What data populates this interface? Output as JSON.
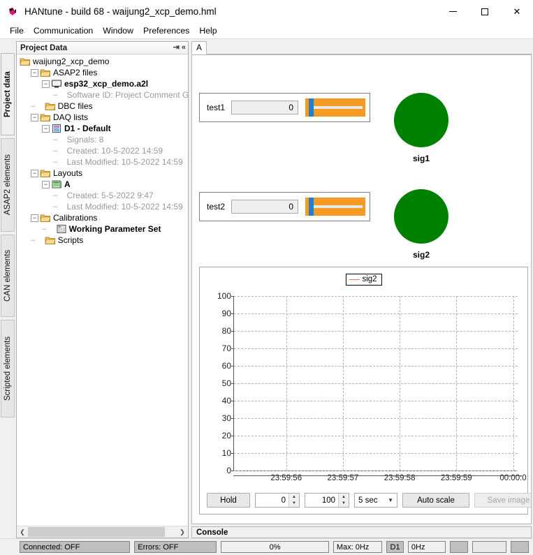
{
  "window": {
    "title": "HANtune - build 68 - waijung2_xcp_demo.hml",
    "icon": "hantune-logo-icon",
    "minimize_label": "",
    "maximize_label": "",
    "close_label": "✕"
  },
  "menubar": {
    "items": [
      "File",
      "Communication",
      "Window",
      "Preferences",
      "Help"
    ]
  },
  "vertical_tabs": [
    {
      "label": "Project data",
      "active": true
    },
    {
      "label": "ASAP2 elements",
      "active": false
    },
    {
      "label": "CAN elements",
      "active": false
    },
    {
      "label": "Scripted elements",
      "active": false
    }
  ],
  "tree_panel": {
    "header": "Project Data",
    "pin_icon": "pin-icon",
    "collapse_icon": "collapse-left-icon",
    "nodes": [
      {
        "label": "waijung2_xcp_demo",
        "depth": 0,
        "icon": "folder-icon",
        "expander": "",
        "style": "normal"
      },
      {
        "label": "ASAP2 files",
        "depth": 1,
        "icon": "folder-icon",
        "expander": "−",
        "style": "normal"
      },
      {
        "label": "esp32_xcp_demo.a2l",
        "depth": 2,
        "icon": "monitor-icon",
        "expander": "−",
        "style": "bold"
      },
      {
        "label": "Software ID: Project Comment Goes H",
        "depth": 3,
        "icon": "none",
        "expander": "",
        "style": "muted"
      },
      {
        "label": "DBC files",
        "depth": 1,
        "icon": "folder-icon",
        "expander": "",
        "style": "normal"
      },
      {
        "label": "DAQ lists",
        "depth": 1,
        "icon": "folder-icon",
        "expander": "−",
        "style": "normal"
      },
      {
        "label": "D1 - Default",
        "depth": 2,
        "icon": "list-icon",
        "expander": "−",
        "style": "bold"
      },
      {
        "label": "Signals: 8",
        "depth": 3,
        "icon": "none",
        "expander": "",
        "style": "muted"
      },
      {
        "label": "Created: 10-5-2022 14:59",
        "depth": 3,
        "icon": "none",
        "expander": "",
        "style": "muted"
      },
      {
        "label": "Last Modified: 10-5-2022 14:59",
        "depth": 3,
        "icon": "none",
        "expander": "",
        "style": "muted"
      },
      {
        "label": "Layouts",
        "depth": 1,
        "icon": "folder-icon",
        "expander": "−",
        "style": "normal"
      },
      {
        "label": "A",
        "depth": 2,
        "icon": "layout-icon",
        "expander": "−",
        "style": "bold"
      },
      {
        "label": "Created: 5-5-2022 9:47",
        "depth": 3,
        "icon": "none",
        "expander": "",
        "style": "muted"
      },
      {
        "label": "Last Modified: 10-5-2022 14:59",
        "depth": 3,
        "icon": "none",
        "expander": "",
        "style": "muted"
      },
      {
        "label": "Calibrations",
        "depth": 1,
        "icon": "folder-icon",
        "expander": "−",
        "style": "normal"
      },
      {
        "label": "Working Parameter Set",
        "depth": 2,
        "icon": "table-icon",
        "expander": "",
        "style": "bold"
      },
      {
        "label": "Scripts",
        "depth": 1,
        "icon": "folder-icon",
        "expander": "",
        "style": "normal"
      }
    ],
    "scroll_left_icon": "chevron-left-icon",
    "scroll_right_icon": "chevron-right-icon"
  },
  "layout_tabs": [
    {
      "label": "A",
      "active": true
    }
  ],
  "widgets": {
    "gauges": [
      {
        "label": "test1",
        "value": "0",
        "bar_color": "#f59a23",
        "knob_color": "#1f7fd0"
      },
      {
        "label": "test2",
        "value": "0",
        "bar_color": "#f59a23",
        "knob_color": "#1f7fd0"
      }
    ],
    "leds": [
      {
        "label": "sig1",
        "color": "#008000"
      },
      {
        "label": "sig2",
        "color": "#008000"
      }
    ]
  },
  "chart_data": {
    "type": "line",
    "title": "",
    "xlabel": "",
    "ylabel": "",
    "legend": [
      {
        "name": "sig2",
        "color": "#e8736a"
      }
    ],
    "legend_position": "top-center",
    "grid": true,
    "ylim": [
      0,
      100
    ],
    "yticks": [
      0,
      10,
      20,
      30,
      40,
      50,
      60,
      70,
      80,
      90,
      100
    ],
    "xticks": [
      "23:59:56",
      "23:59:57",
      "23:59:58",
      "23:59:59",
      "00:00:0"
    ],
    "series": [
      {
        "name": "sig2",
        "values": []
      }
    ]
  },
  "chart_controls": {
    "hold_label": "Hold",
    "min_value": "0",
    "max_value": "100",
    "timespan_value": "5 sec",
    "autoscale_label": "Auto scale",
    "save_image_label": "Save image",
    "save_image_enabled": false,
    "spin_up_icon": "spin-up-icon",
    "spin_down_icon": "spin-down-icon",
    "dropdown_icon": "chevron-down-icon"
  },
  "console": {
    "title": "Console"
  },
  "statusbar": {
    "connected": "Connected: OFF",
    "errors": "Errors: OFF",
    "progress": "0%",
    "max_rate": "Max: 0Hz",
    "daq": "D1",
    "rate": "0Hz"
  }
}
